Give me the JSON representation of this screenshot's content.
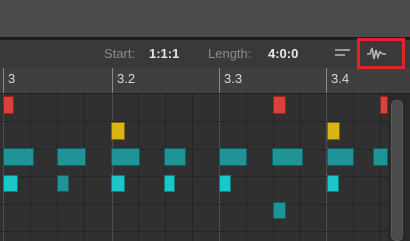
{
  "toolbar": {
    "start_label": "Start:",
    "start_value": "1:1:1",
    "length_label": "Length:",
    "length_value": "4:0:0",
    "icons": [
      "lines-icon",
      "waveform-icon"
    ]
  },
  "ruler": {
    "labels": [
      "3",
      "3.2",
      "3.3",
      "3.4"
    ]
  },
  "colors": {
    "red": "#d8413c",
    "yellow": "#d9b513",
    "teal": "#1f9497",
    "cyan": "#1ac6c8",
    "highlight": "#e5212b"
  }
}
